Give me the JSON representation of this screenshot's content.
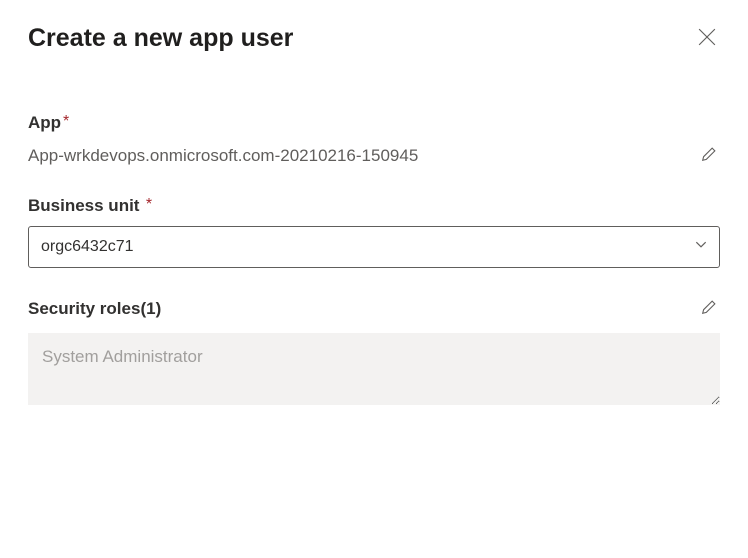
{
  "header": {
    "title": "Create a new app user"
  },
  "fields": {
    "app": {
      "label": "App",
      "required_mark": "*",
      "value": "App-wrkdevops.onmicrosoft.com-20210216-150945"
    },
    "business_unit": {
      "label": "Business unit",
      "required_mark": "*",
      "value": "orgc6432c71"
    },
    "security_roles": {
      "label": "Security roles",
      "count_suffix": "(1)",
      "value": "System Administrator"
    }
  }
}
